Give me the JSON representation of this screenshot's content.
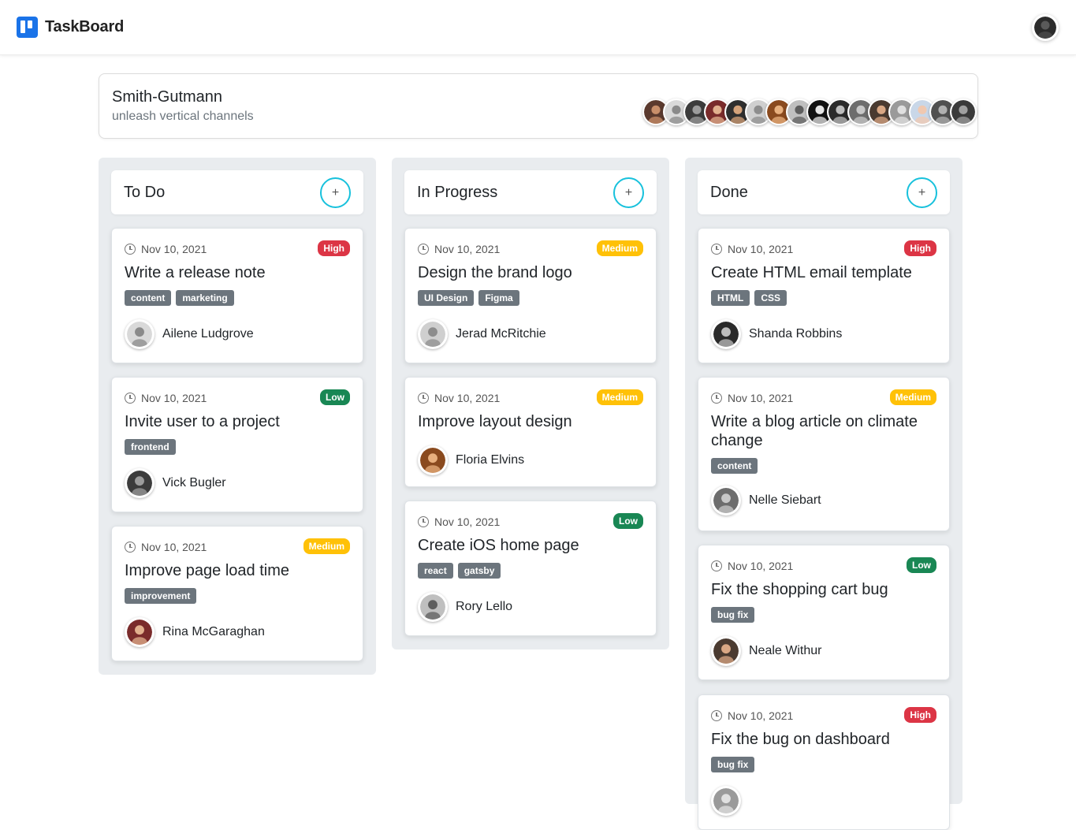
{
  "app": {
    "name": "TaskBoard"
  },
  "project": {
    "name": "Smith-Gutmann",
    "subtitle": "unleash vertical channels",
    "member_count": 16
  },
  "columns": [
    {
      "title": "To Do",
      "cards": [
        {
          "date": "Nov 10, 2021",
          "priority": "High",
          "title": "Write a release note",
          "tags": [
            "content",
            "marketing"
          ],
          "assignee": "Ailene Ludgrove"
        },
        {
          "date": "Nov 10, 2021",
          "priority": "Low",
          "title": "Invite user to a project",
          "tags": [
            "frontend"
          ],
          "assignee": "Vick Bugler"
        },
        {
          "date": "Nov 10, 2021",
          "priority": "Medium",
          "title": "Improve page load time",
          "tags": [
            "improvement"
          ],
          "assignee": "Rina McGaraghan"
        }
      ]
    },
    {
      "title": "In Progress",
      "cards": [
        {
          "date": "Nov 10, 2021",
          "priority": "Medium",
          "title": "Design the brand logo",
          "tags": [
            "UI Design",
            "Figma"
          ],
          "assignee": "Jerad McRitchie"
        },
        {
          "date": "Nov 10, 2021",
          "priority": "Medium",
          "title": "Improve layout design",
          "tags": [],
          "assignee": "Floria Elvins"
        },
        {
          "date": "Nov 10, 2021",
          "priority": "Low",
          "title": "Create iOS home page",
          "tags": [
            "react",
            "gatsby"
          ],
          "assignee": "Rory Lello"
        }
      ]
    },
    {
      "title": "Done",
      "cards": [
        {
          "date": "Nov 10, 2021",
          "priority": "High",
          "title": "Create HTML email template",
          "tags": [
            "HTML",
            "CSS"
          ],
          "assignee": "Shanda Robbins"
        },
        {
          "date": "Nov 10, 2021",
          "priority": "Medium",
          "title": "Write a blog article on climate change",
          "tags": [
            "content"
          ],
          "assignee": "Nelle Siebart"
        },
        {
          "date": "Nov 10, 2021",
          "priority": "Low",
          "title": "Fix the shopping cart bug",
          "tags": [
            "bug fix"
          ],
          "assignee": "Neale Withur"
        },
        {
          "date": "Nov 10, 2021",
          "priority": "High",
          "title": "Fix the bug on dashboard",
          "tags": [
            "bug fix"
          ],
          "assignee": ""
        }
      ]
    }
  ],
  "add_button_label": "+",
  "colors": {
    "brand": "#1a73e8",
    "high": "#dc3545",
    "low": "#198754",
    "medium": "#ffc107",
    "tag": "#6c757d",
    "add_ring": "#17c1dc"
  },
  "icons": {
    "date": "clock-icon",
    "add": "plus-icon"
  }
}
